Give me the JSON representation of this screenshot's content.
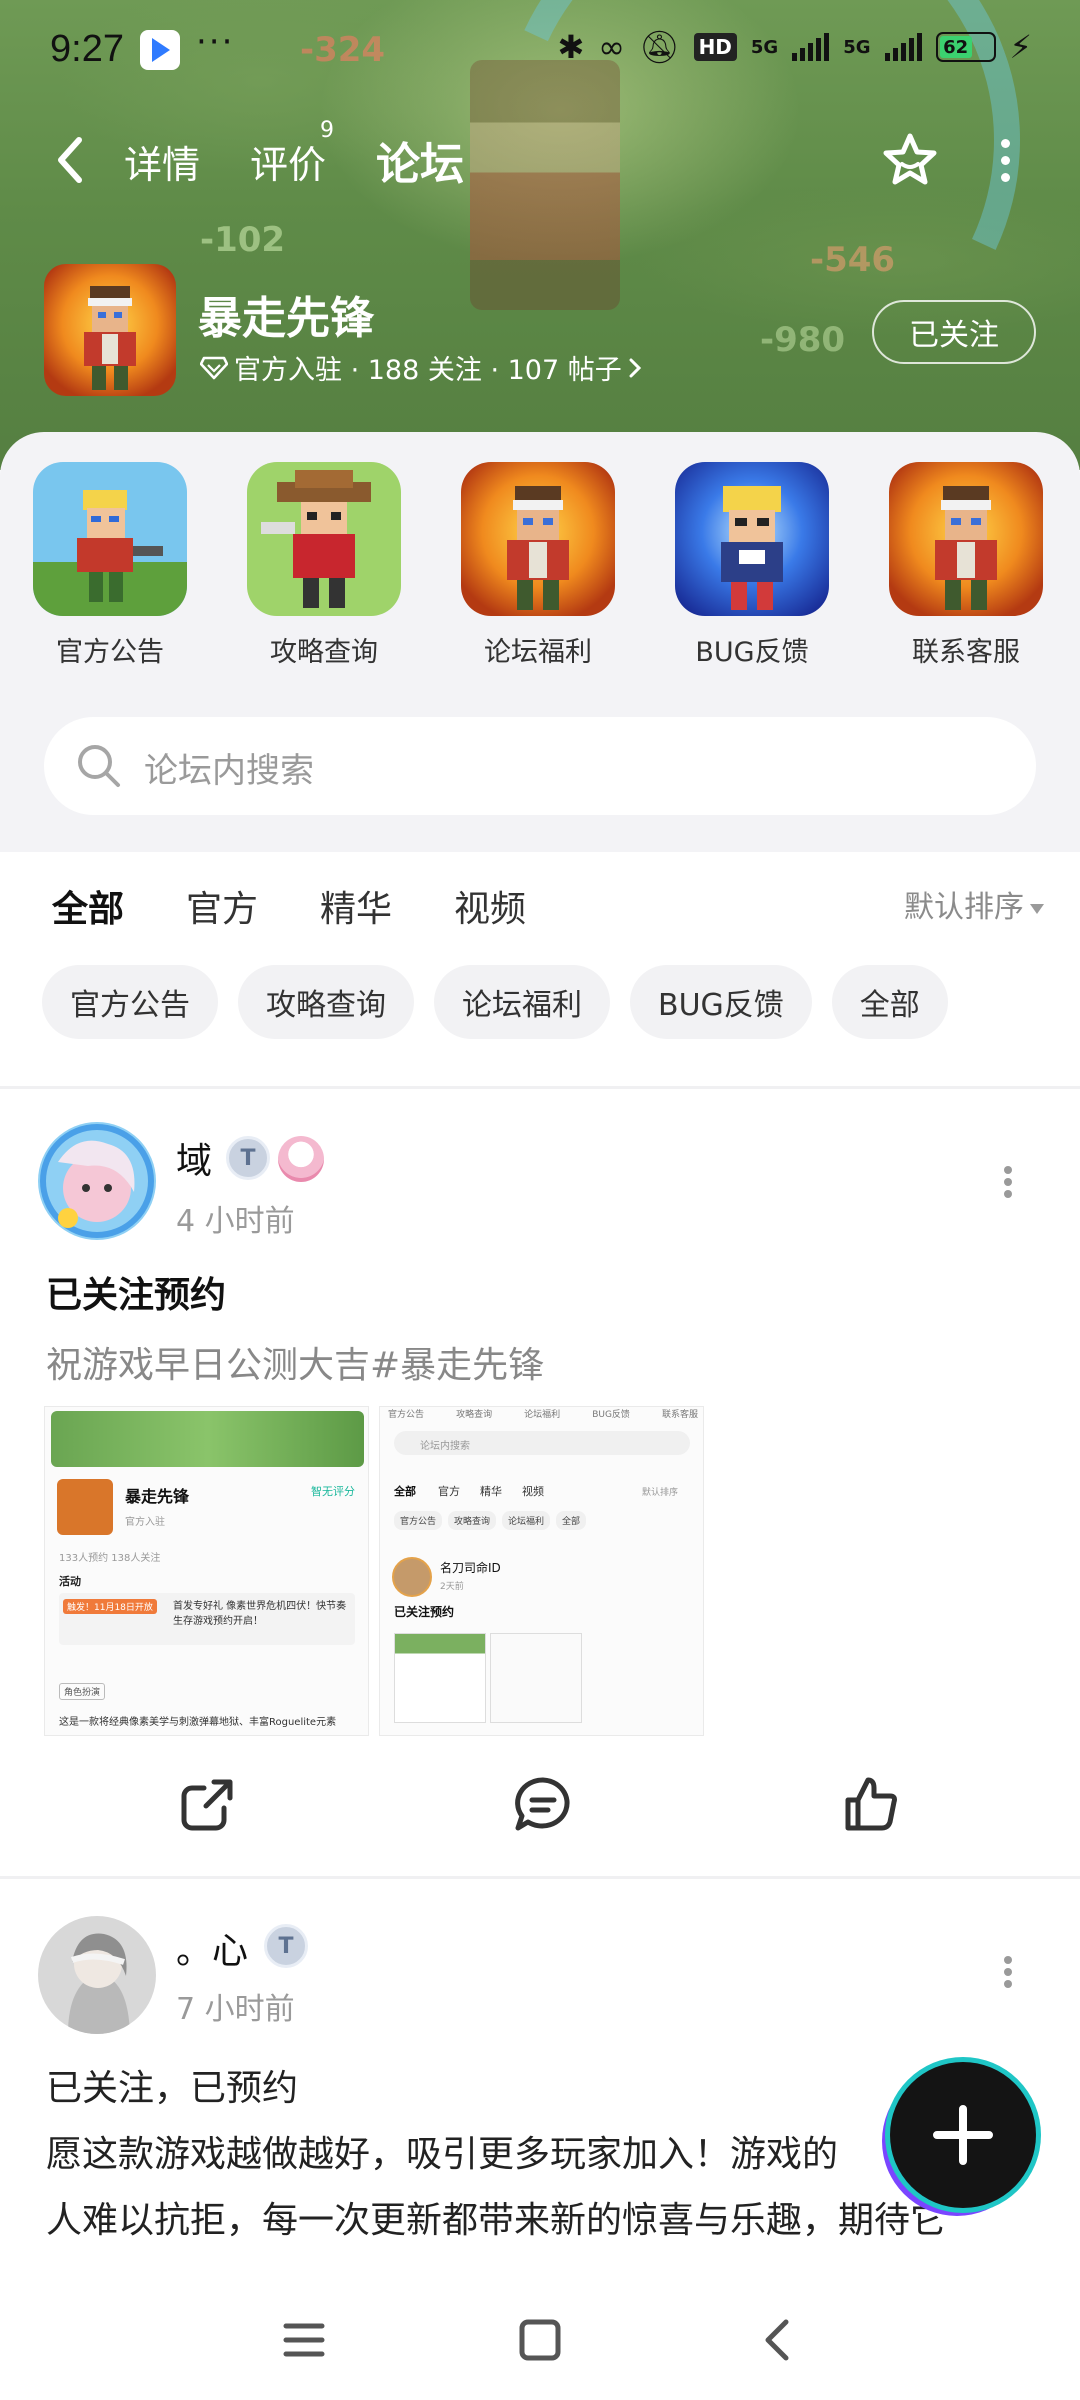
{
  "status_bar": {
    "time": "9:27",
    "dots": "···",
    "net": "5G",
    "hd": "HD",
    "battery": "62"
  },
  "nav": {
    "tabs": [
      {
        "label": "详情"
      },
      {
        "label": "评价",
        "badge": "9"
      },
      {
        "label": "论坛"
      }
    ]
  },
  "game": {
    "name": "暴走先锋",
    "meta": "官方入驻 · 188 关注 · 107 帖子",
    "follow_label": "已关注"
  },
  "quick_entries": [
    {
      "label": "官方公告"
    },
    {
      "label": "攻略查询"
    },
    {
      "label": "论坛福利"
    },
    {
      "label": "BUG反馈"
    },
    {
      "label": "联系客服"
    }
  ],
  "search": {
    "placeholder": "论坛内搜索"
  },
  "filter_tabs": [
    {
      "label": "全部"
    },
    {
      "label": "官方"
    },
    {
      "label": "精华"
    },
    {
      "label": "视频"
    }
  ],
  "sort_label": "默认排序",
  "chips": [
    {
      "label": "官方公告"
    },
    {
      "label": "攻略查询"
    },
    {
      "label": "论坛福利"
    },
    {
      "label": "BUG反馈"
    },
    {
      "label": "全部"
    }
  ],
  "posts": [
    {
      "user": "域",
      "badge": "T",
      "time": "4 小时前",
      "title": "已关注预约",
      "body": "祝游戏早日公测大吉#暴走先锋",
      "shot1": {
        "game_name": "暴走先锋",
        "rate_label": "智无评分",
        "official_label": "官方入驻",
        "stats": "133人预约   138人关注",
        "activity_label": "活动",
        "activity_tag": "触发！11月18日开放",
        "activity_text": "首发专好礼 像素世界危机四伏！快节奏生存游戏预约开启！",
        "role_tag": "角色扮演",
        "intro": "这是一款将经典像素美学与刺激弹幕地狱、丰富Roguelite元素"
      },
      "shot2": {
        "tabs": [
          "官方公告",
          "攻略查询",
          "论坛福利",
          "BUG反馈",
          "联系客服"
        ],
        "search_placeholder": "论坛内搜索",
        "filters": [
          "全部",
          "官方",
          "精华",
          "视频"
        ],
        "sort": "默认排序",
        "chips": [
          "官方公告",
          "攻略查询",
          "论坛福利",
          "全部"
        ],
        "user": "名刀司命ID",
        "time": "2天前",
        "title": "已关注预约"
      }
    },
    {
      "user": "。心",
      "badge": "T",
      "time": "7 小时前",
      "title_line": "已关注，已预约",
      "line2": "愿这款游戏越做越好，吸引更多玩家加入！游戏的",
      "line3": "人难以抗拒，每一次更新都带来新的惊喜与乐趣，期待它"
    }
  ],
  "colors": {
    "accent": "#25d0b5",
    "panel_bg": "#f3f3f6",
    "muted": "#9a9a9a"
  }
}
